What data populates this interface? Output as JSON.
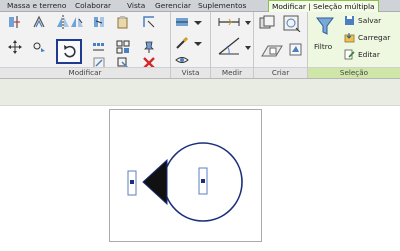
{
  "tabs": [
    {
      "label": "Massa e terreno",
      "active": false
    },
    {
      "label": "Colaborar",
      "active": false
    },
    {
      "label": "Vista",
      "active": false
    },
    {
      "label": "Gerenciar",
      "active": false
    },
    {
      "label": "Suplementos",
      "active": false
    },
    {
      "label": "Modificar | Seleção múltipla",
      "active": true
    }
  ],
  "panels": {
    "modificar": "Modificar",
    "vista": "Vista",
    "medir": "Medir",
    "criar": "Criar",
    "selecao": "Seleção"
  },
  "buttons": {
    "filtro": "Filtro",
    "salvar": "Salvar",
    "carregar": "Carregar",
    "editar": "Editar"
  },
  "colors": {
    "active_tab": "#8dbf4d",
    "selection_highlight": "#1f3a8f",
    "drawing_stroke": "#1b2f7a"
  },
  "icons": [
    "move-icon",
    "copy-icon",
    "rotate-icon",
    "mirror-icon",
    "array-icon",
    "scale-icon",
    "delete-icon",
    "filter-icon",
    "save-selection-icon",
    "load-selection-icon",
    "edit-selection-icon"
  ]
}
